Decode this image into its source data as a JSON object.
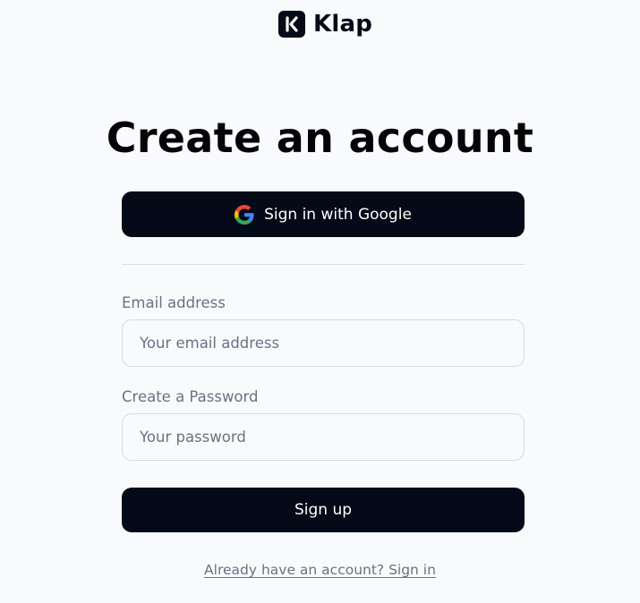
{
  "brand": {
    "name": "Klap",
    "icon": "klap-logo-icon",
    "color": "#050a18"
  },
  "page": {
    "title": "Create an account",
    "background": "#f8fafc"
  },
  "google_button": {
    "label": "Sign in with Google",
    "icon": "google-icon"
  },
  "form": {
    "email": {
      "label": "Email address",
      "placeholder": "Your email address",
      "value": ""
    },
    "password": {
      "label": "Create a Password",
      "placeholder": "Your password",
      "value": ""
    },
    "submit_label": "Sign up"
  },
  "footer": {
    "signin_link": "Already have an account? Sign in"
  },
  "colors": {
    "primary_button": "#050a18",
    "muted_text": "#6b7280",
    "input_border": "#d6dbe1"
  }
}
